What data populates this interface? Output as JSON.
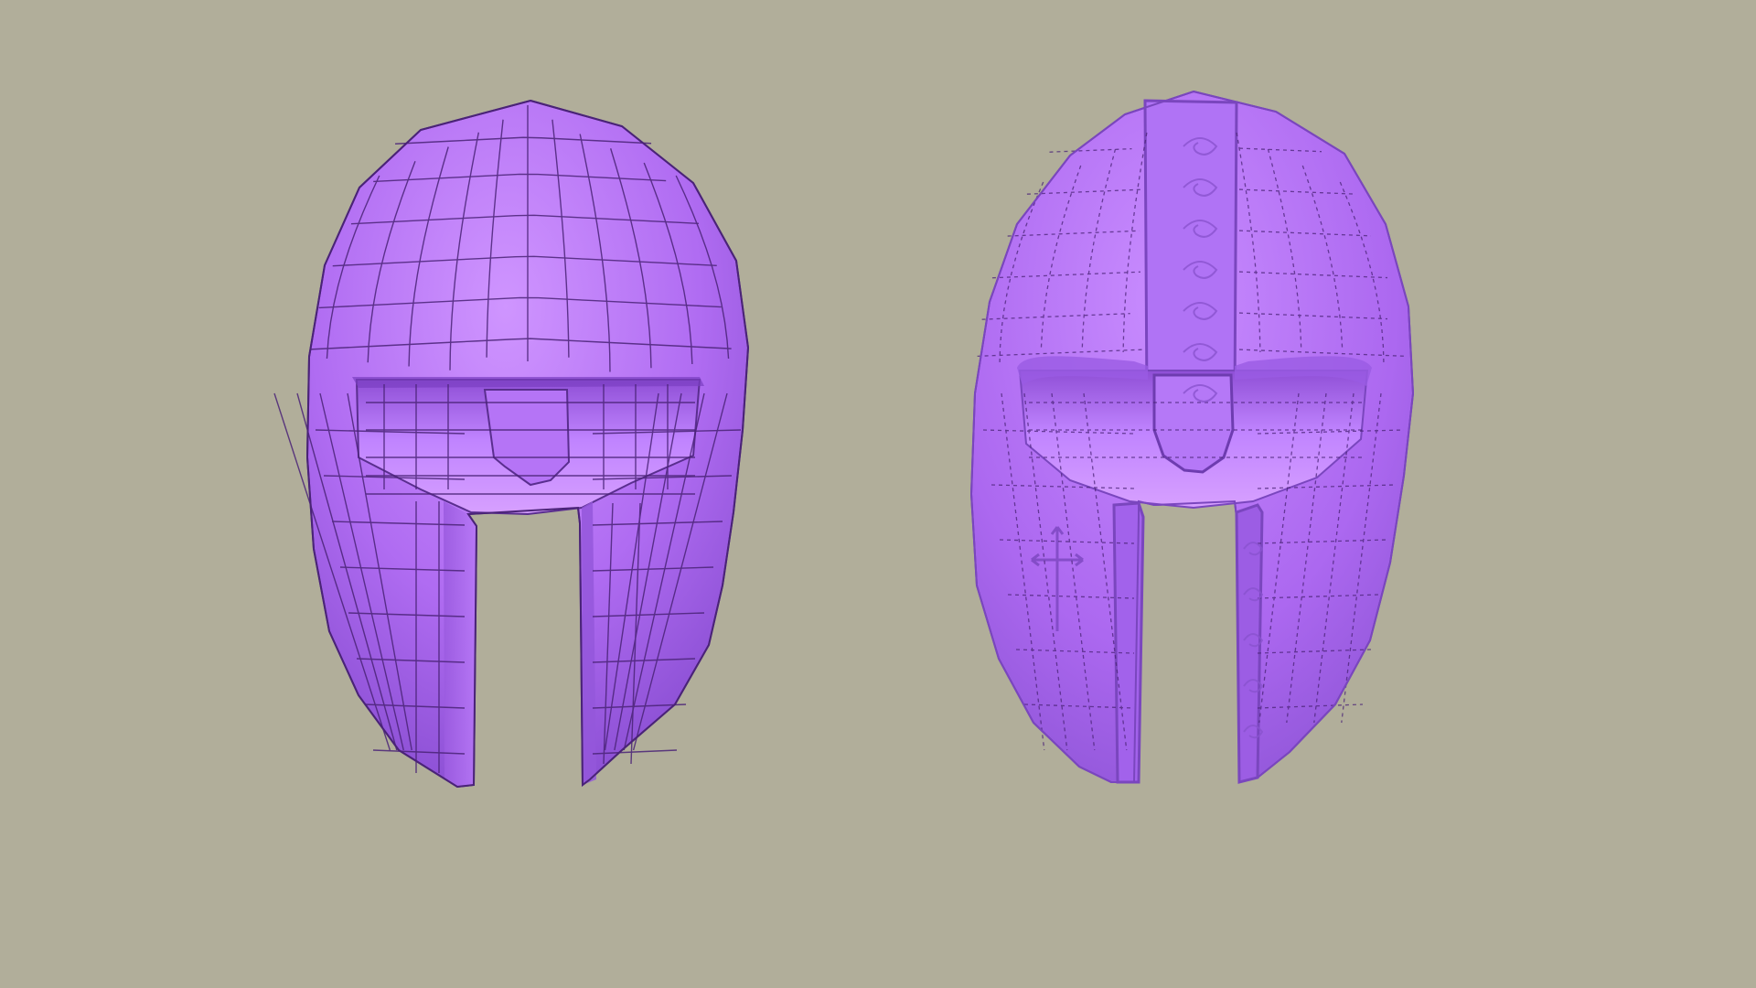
{
  "scene": {
    "background_color": "#B1AE9A",
    "helmet_base_color": "#B06CF2",
    "helmet_light_color": "#D39BFF",
    "helmet_shadow_color": "#7C3FC4",
    "wire_color": "#4A2377",
    "models": [
      {
        "name": "low-poly-helmet",
        "wireframe": "solid",
        "detail": "plain"
      },
      {
        "name": "sculpted-helmet",
        "wireframe": "dashed",
        "detail": "ornamented"
      }
    ]
  }
}
